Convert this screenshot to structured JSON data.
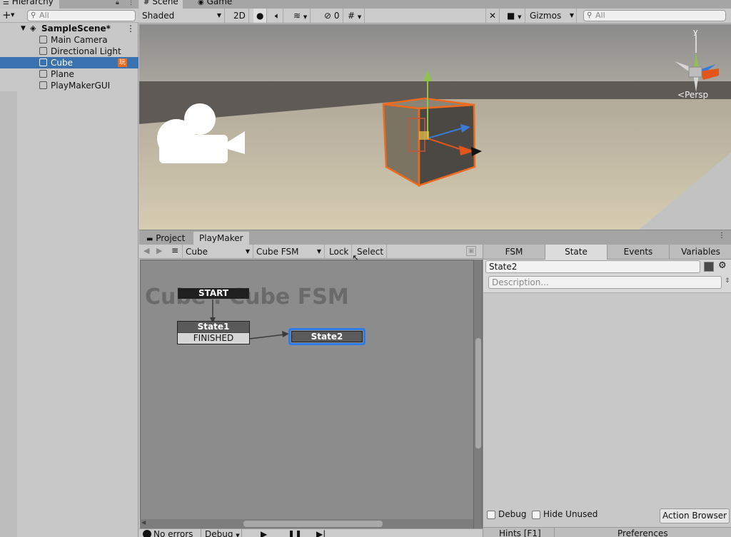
{
  "hierarchy": {
    "title": "Hierarchy",
    "add_label": "+",
    "search_placeholder": "All",
    "scene_name": "SampleScene*",
    "items": [
      {
        "label": "Main Camera"
      },
      {
        "label": "Directional Light"
      },
      {
        "label": "Cube",
        "badge": "玩"
      },
      {
        "label": "Plane"
      },
      {
        "label": "PlayMakerGUI"
      }
    ]
  },
  "scene": {
    "tabs": [
      {
        "label": "Scene"
      },
      {
        "label": "Game"
      }
    ],
    "toolbar": {
      "draw_mode": "Shaded",
      "mode_2d": "2D",
      "hidden_count": "0",
      "gizmos_label": "Gizmos",
      "search_placeholder": "All"
    },
    "gizmo": {
      "axis_label": "y",
      "projection": "Persp"
    },
    "colors": {
      "sky": "#8b8b8b",
      "ground": "#cfc3a3",
      "selection_outline": "#ee6a1c"
    }
  },
  "playmaker": {
    "tabs": [
      {
        "label": "Project"
      },
      {
        "label": "PlayMaker"
      }
    ],
    "toolbar": {
      "gameobject": "Cube",
      "fsm": "Cube FSM",
      "lock_label": "Lock",
      "select_label": "Select"
    },
    "graph_title": "Cube : Cube FSM",
    "start_label": "START",
    "states": [
      {
        "name": "State1",
        "event": "FINISHED"
      },
      {
        "name": "State2",
        "selected": true
      }
    ],
    "bottom": {
      "errors": "No errors",
      "debug_label": "Debug"
    },
    "colors": {
      "canvas": "#8c8c8c",
      "selection": "#2f7de8"
    }
  },
  "inspector": {
    "tabs": [
      {
        "label": "FSM"
      },
      {
        "label": "State"
      },
      {
        "label": "Events"
      },
      {
        "label": "Variables"
      }
    ],
    "active_tab": "State",
    "state_name": "State2",
    "description_placeholder": "Description...",
    "debug_label": "Debug",
    "hide_unused_label": "Hide Unused",
    "action_browser_label": "Action Browser",
    "hints_label": "Hints [F1]",
    "preferences_label": "Preferences"
  }
}
